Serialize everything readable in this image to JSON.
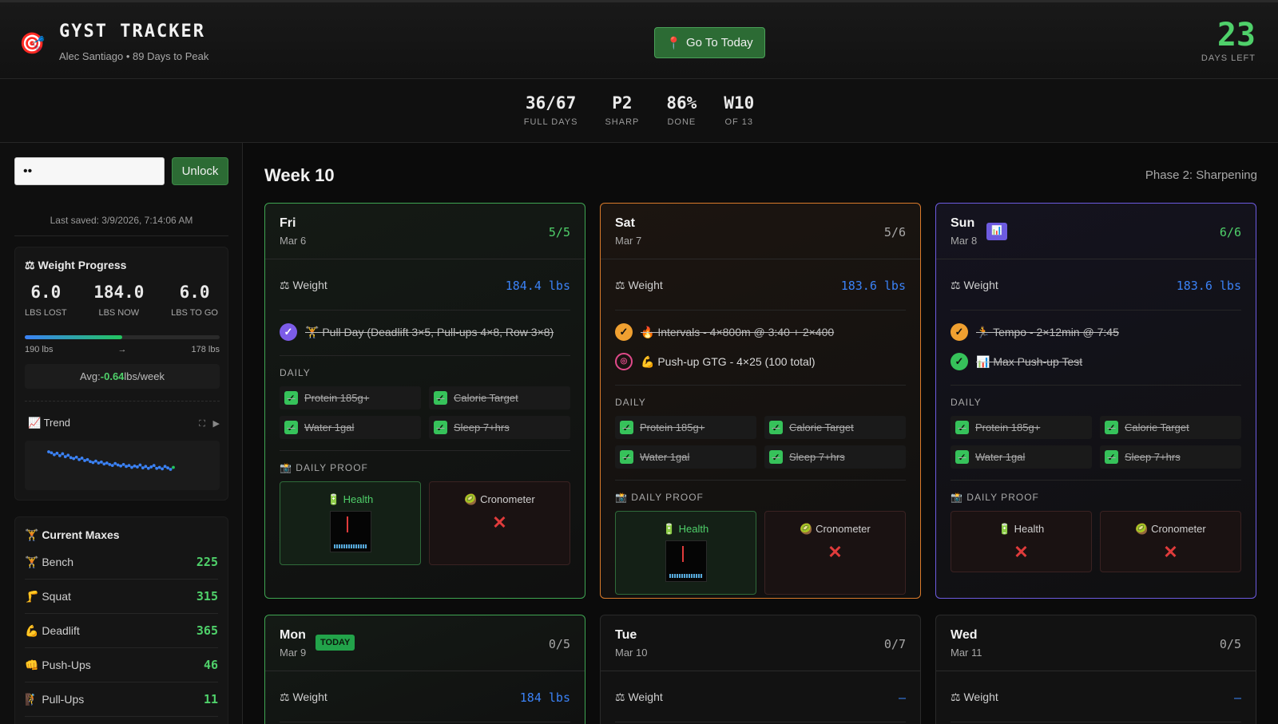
{
  "header": {
    "logo_icon": "🎯",
    "title": "GYST TRACKER",
    "subtitle": "Alec Santiago • 89 Days to Peak",
    "go_today_icon": "📍",
    "go_today_label": "Go To Today",
    "days_left_value": "23",
    "days_left_label": "DAYS LEFT"
  },
  "stats": [
    {
      "value": "36/67",
      "label": "FULL DAYS"
    },
    {
      "value": "P2",
      "label": "SHARP"
    },
    {
      "value": "86%",
      "label": "DONE"
    },
    {
      "value": "W10",
      "label": "OF 13"
    }
  ],
  "sidebar": {
    "password_value": "••",
    "unlock_label": "Unlock",
    "last_saved": "Last saved: 3/9/2026, 7:14:06 AM",
    "weight": {
      "title": "⚖ Weight Progress",
      "lost_value": "6.0",
      "lost_label": "LBS LOST",
      "now_value": "184.0",
      "now_label": "LBS NOW",
      "togo_value": "6.0",
      "togo_label": "LBS TO GO",
      "progress_fraction": 0.5,
      "start": "190 lbs",
      "arrow": "→",
      "goal": "178 lbs",
      "avg_prefix": "Avg: ",
      "avg_value": "-0.64",
      "avg_suffix": " lbs/week",
      "trend_label": "📈 Trend",
      "trend_expand_icon": "⛶",
      "trend_play_icon": "▶"
    },
    "maxes": {
      "title": "🏋 Current Maxes",
      "items": [
        {
          "icon": "🏋",
          "name": "Bench",
          "value": "225"
        },
        {
          "icon": "🦵",
          "name": "Squat",
          "value": "315"
        },
        {
          "icon": "💪",
          "name": "Deadlift",
          "value": "365"
        },
        {
          "icon": "👊",
          "name": "Push-Ups",
          "value": "46"
        },
        {
          "icon": "🧗",
          "name": "Pull-Ups",
          "value": "11"
        }
      ]
    }
  },
  "main": {
    "week_title": "Week 10",
    "phase": "Phase 2: Sharpening",
    "weight_label": "⚖ Weight",
    "daily_label": "DAILY",
    "proof_label": "📸 DAILY PROOF",
    "health_label": "🔋 Health",
    "cronometer_label": "🥝 Cronometer",
    "x_mark": "✕",
    "check": "✓",
    "days": [
      {
        "day": "Fri",
        "date": "Mar 6",
        "score": "5/5",
        "weight": "184.4 lbs",
        "workouts": [
          {
            "text": "🏋 Pull Day (Deadlift 3×5, Pull-ups 4×8, Row 3×8)"
          }
        ],
        "daily": [
          "Protein 185g+",
          "Calorie Target",
          "Water 1gal",
          "Sleep 7+hrs"
        ]
      },
      {
        "day": "Sat",
        "date": "Mar 7",
        "score": "5/6",
        "weight": "183.6 lbs",
        "workouts": [
          {
            "text": "🔥 Intervals - 4×800m @ 3:40 + 2×400"
          },
          {
            "text": "💪 Push-up GTG - 4×25 (100 total)"
          }
        ],
        "daily": [
          "Protein 185g+",
          "Calorie Target",
          "Water 1gal",
          "Sleep 7+hrs"
        ]
      },
      {
        "day": "Sun",
        "date": "Mar 8",
        "score": "6/6",
        "weight": "183.6 lbs",
        "badge": "📊",
        "workouts": [
          {
            "text": "🏃 Tempo - 2×12min @ 7:45"
          },
          {
            "text": "📊 Max Push-up Test"
          }
        ],
        "daily": [
          "Protein 185g+",
          "Calorie Target",
          "Water 1gal",
          "Sleep 7+hrs"
        ]
      },
      {
        "day": "Mon",
        "date": "Mar 9",
        "score": "0/5",
        "weight": "184 lbs",
        "badge": "TODAY"
      },
      {
        "day": "Tue",
        "date": "Mar 10",
        "score": "0/7",
        "weight": "–"
      },
      {
        "day": "Wed",
        "date": "Mar 11",
        "score": "0/5",
        "weight": "–"
      }
    ]
  },
  "trend_points": [
    187.2,
    187.0,
    186.6,
    186.9,
    186.4,
    186.8,
    186.2,
    186.5,
    186.0,
    185.8,
    186.1,
    185.6,
    185.9,
    185.4,
    185.6,
    185.2,
    185.0,
    185.3,
    184.9,
    185.1,
    184.7,
    184.9,
    184.6,
    184.4,
    184.8,
    184.5,
    184.3,
    184.6,
    184.2,
    184.4,
    184.0,
    184.3,
    184.1,
    184.5,
    183.9,
    184.2,
    183.8,
    184.1,
    184.4,
    183.8,
    184.0,
    183.7,
    184.2,
    183.9,
    183.6,
    184.0
  ]
}
